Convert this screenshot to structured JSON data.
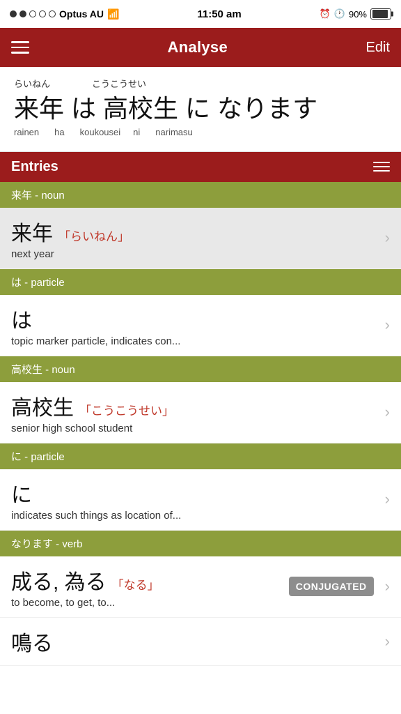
{
  "statusBar": {
    "carrier": "Optus AU",
    "time": "11:50 am",
    "battery": "90%"
  },
  "navBar": {
    "title": "Analyse",
    "editLabel": "Edit"
  },
  "japaneseSentence": {
    "furigana": {
      "rainen": "らいねん",
      "koukou": "こうこうせい"
    },
    "words": [
      "来年",
      "は",
      "高校生",
      "に",
      "なります"
    ],
    "romanji": {
      "rainen": "rainen",
      "ha": "ha",
      "koukousei": "koukousei",
      "ni": "ni",
      "narimasu": "narimasu"
    }
  },
  "entries": {
    "title": "Entries",
    "categories": [
      {
        "header": "来年 - noun",
        "items": [
          {
            "kanji": "来年",
            "reading": "「らいねん」",
            "definition": "next year",
            "selected": true,
            "conjugated": false
          }
        ]
      },
      {
        "header": "は - particle",
        "items": [
          {
            "kanji": "は",
            "reading": "",
            "definition": "topic marker particle, indicates con...",
            "selected": false,
            "conjugated": false
          }
        ]
      },
      {
        "header": "高校生 - noun",
        "items": [
          {
            "kanji": "高校生",
            "reading": "「こうこうせい」",
            "definition": "senior high school student",
            "selected": false,
            "conjugated": false
          }
        ]
      },
      {
        "header": "に - particle",
        "items": [
          {
            "kanji": "に",
            "reading": "",
            "definition": "indicates such things as location of...",
            "selected": false,
            "conjugated": false
          }
        ]
      },
      {
        "header": "なります - verb",
        "items": [
          {
            "kanji": "成る, 為る",
            "reading": "「なる」",
            "definition": "to become, to get, to...",
            "selected": false,
            "conjugated": true
          },
          {
            "kanji": "鳴る",
            "reading": "",
            "definition": "",
            "selected": false,
            "conjugated": false
          }
        ]
      }
    ]
  }
}
